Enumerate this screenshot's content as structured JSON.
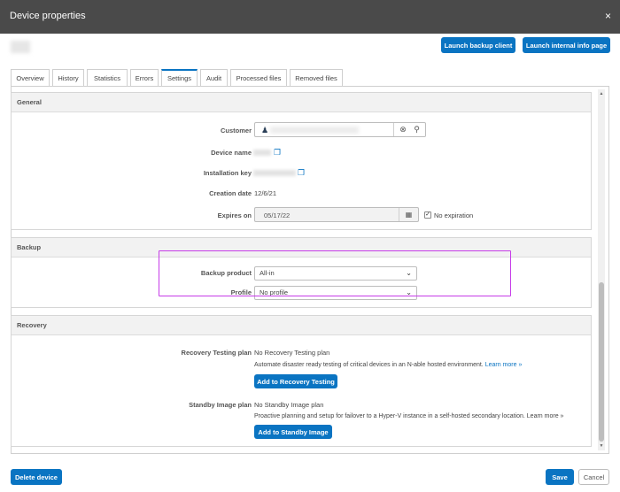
{
  "window": {
    "title": "Device properties",
    "close_glyph": "×"
  },
  "toolbar": {
    "launch_backup_label": "Launch backup client",
    "launch_info_label": "Launch internal info page"
  },
  "tabs": [
    {
      "label": "Overview"
    },
    {
      "label": "History"
    },
    {
      "label": "Statistics"
    },
    {
      "label": "Errors"
    },
    {
      "label": "Settings",
      "active": true
    },
    {
      "label": "Audit"
    },
    {
      "label": "Processed files"
    },
    {
      "label": "Removed files"
    }
  ],
  "general": {
    "header": "General",
    "customer_label": "Customer",
    "device_name_label": "Device name",
    "installation_key_label": "Installation key",
    "creation_date_label": "Creation date",
    "creation_date_value": "12/6/21",
    "expires_on_label": "Expires on",
    "expires_on_value": "05/17/22",
    "no_expiration_label": "No expiration",
    "no_expiration_checked": true
  },
  "backup": {
    "header": "Backup",
    "backup_product_label": "Backup product",
    "backup_product_value": "All-in",
    "profile_label": "Profile",
    "profile_value": "No profile"
  },
  "recovery": {
    "header": "Recovery",
    "testing_label": "Recovery Testing plan",
    "testing_status": "No Recovery Testing plan",
    "testing_description": "Automate disaster ready testing of critical devices in an N-able hosted environment. ",
    "testing_link": "Learn more »",
    "testing_button": "Add to Recovery Testing",
    "standby_label": "Standby Image plan",
    "standby_status": "No Standby Image plan",
    "standby_description": "Proactive planning and setup for failover to a Hyper-V instance in a self-hosted secondary location. Learn more »",
    "standby_button": "Add to Standby Image"
  },
  "footer": {
    "delete_label": "Delete device",
    "save_label": "Save",
    "cancel_label": "Cancel"
  },
  "colors": {
    "accent": "#0a74c2",
    "highlight": "#c63be8",
    "titlebar": "#4a4a4a"
  },
  "icons": {
    "close": "close-icon",
    "person": "person-icon",
    "clear": "clear-circle-icon",
    "search": "search-icon",
    "copy": "copy-icon",
    "calendar": "calendar-icon",
    "checkmark": "checkmark-icon",
    "chevron": "chevron-down-icon"
  }
}
